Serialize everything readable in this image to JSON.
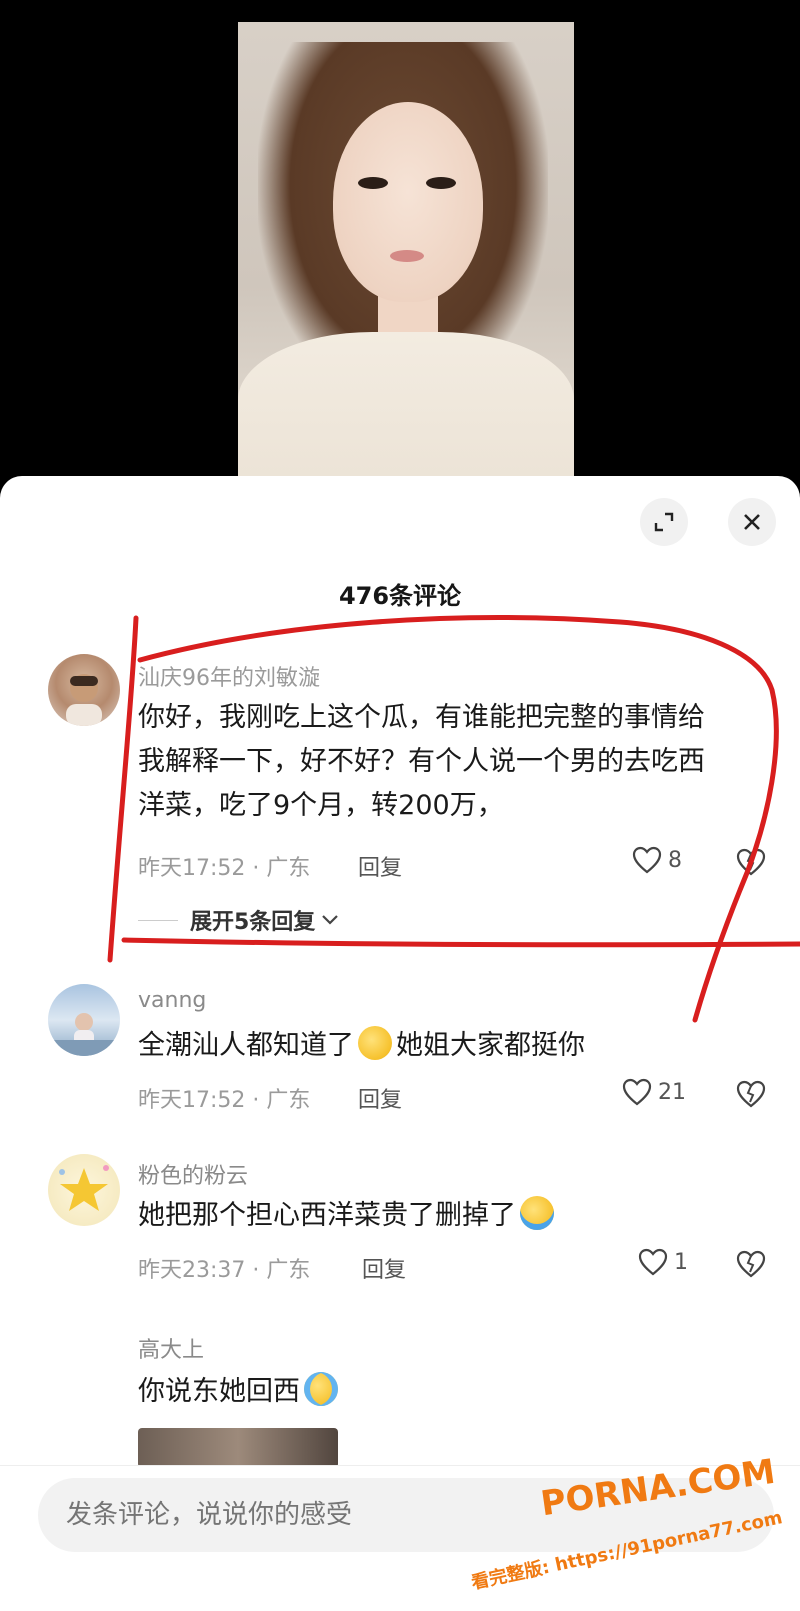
{
  "sheet": {
    "title": "476条评论"
  },
  "comments": [
    {
      "username": "",
      "text": "你好，我刚吃上这个瓜，有谁能把完整的事情给我解释一下，好不好？有个人说一个男的去吃西洋菜，吃了9个月，转200万，",
      "line1": "你好，我刚吃上这个瓜，有谁能把完整的事情给",
      "line2": "我解释一下，好不好？有个人说一个男的去吃西",
      "line3": "洋菜，吃了9个月，转200万，",
      "time": "昨天17:52 · 广东",
      "reply_label": "回复",
      "likes": "8",
      "expand_label": "展开5条回复"
    },
    {
      "username": "vanng",
      "text_before": "全潮汕人都知道了",
      "text_after": "她姐大家都挺你",
      "time": "昨天17:52 · 广东",
      "reply_label": "回复",
      "likes": "21"
    },
    {
      "username": "粉色的粉云",
      "text_before": "她把那个担心西洋菜贵了删掉了",
      "time": "昨天23:37 · 广东",
      "reply_label": "回复",
      "likes": "1"
    },
    {
      "username": "高大上",
      "text_before": "你说东她回西"
    }
  ],
  "input": {
    "placeholder": "发条评论，说说你的感受"
  },
  "watermark": {
    "line1": "PORNA.COM",
    "line2": "看完整版: https://91porna77.com"
  },
  "colors": {
    "annotation": "#d81e1e",
    "watermark": "#f07a12"
  }
}
